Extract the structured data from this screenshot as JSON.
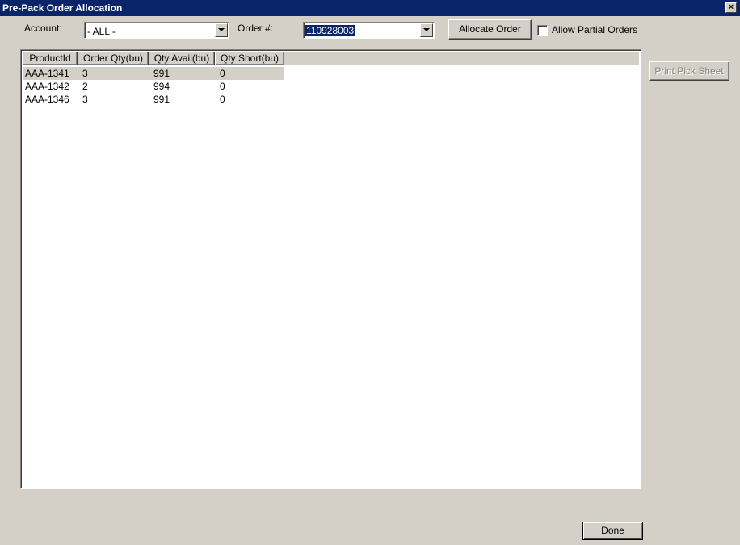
{
  "window": {
    "title": "Pre-Pack Order Allocation",
    "close_glyph": "×"
  },
  "filters": {
    "account_label": "Account:",
    "account_value": "- ALL -",
    "order_label": "Order #:",
    "order_value": "110928003"
  },
  "buttons": {
    "allocate": "Allocate Order",
    "print": "Print Pick Sheet",
    "done": "Done"
  },
  "options": {
    "allow_partial_label": "Allow Partial Orders",
    "allow_partial_checked": false
  },
  "table": {
    "headers": [
      "ProductId",
      "Order Qty(bu)",
      "Qty Avail(bu)",
      "Qty Short(bu)"
    ],
    "rows": [
      [
        "AAA-1341",
        "3",
        "991",
        "0"
      ],
      [
        "AAA-1342",
        "2",
        "994",
        "0"
      ],
      [
        "AAA-1346",
        "3",
        "991",
        "0"
      ]
    ],
    "selected_row": 0
  }
}
